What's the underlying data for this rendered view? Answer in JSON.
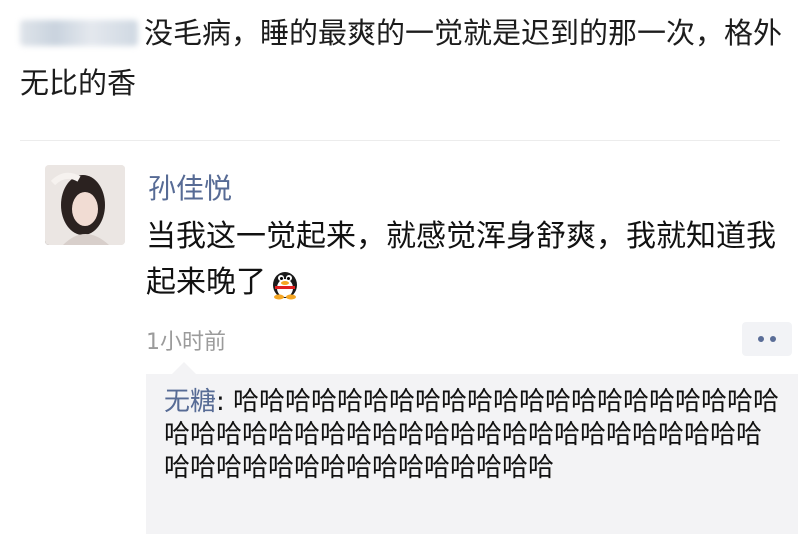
{
  "caption": {
    "text": "没毛病，睡的最爽的一觉就是迟到的那一次，格外无比的香"
  },
  "post": {
    "author": "孙佳悦",
    "text": "当我这一觉起来，就感觉浑身舒爽，我就知道我起来晚了",
    "emoji": "penguin-emoji",
    "time": "1小时前"
  },
  "comment": {
    "author": "无糖",
    "separator": ": ",
    "text": "哈哈哈哈哈哈哈哈哈哈哈哈哈哈哈哈哈哈哈哈哈哈哈哈哈哈哈哈哈哈哈哈哈哈哈哈哈哈哈哈哈哈哈哈哈哈哈哈哈哈哈哈哈哈哈哈哈哈哈"
  }
}
